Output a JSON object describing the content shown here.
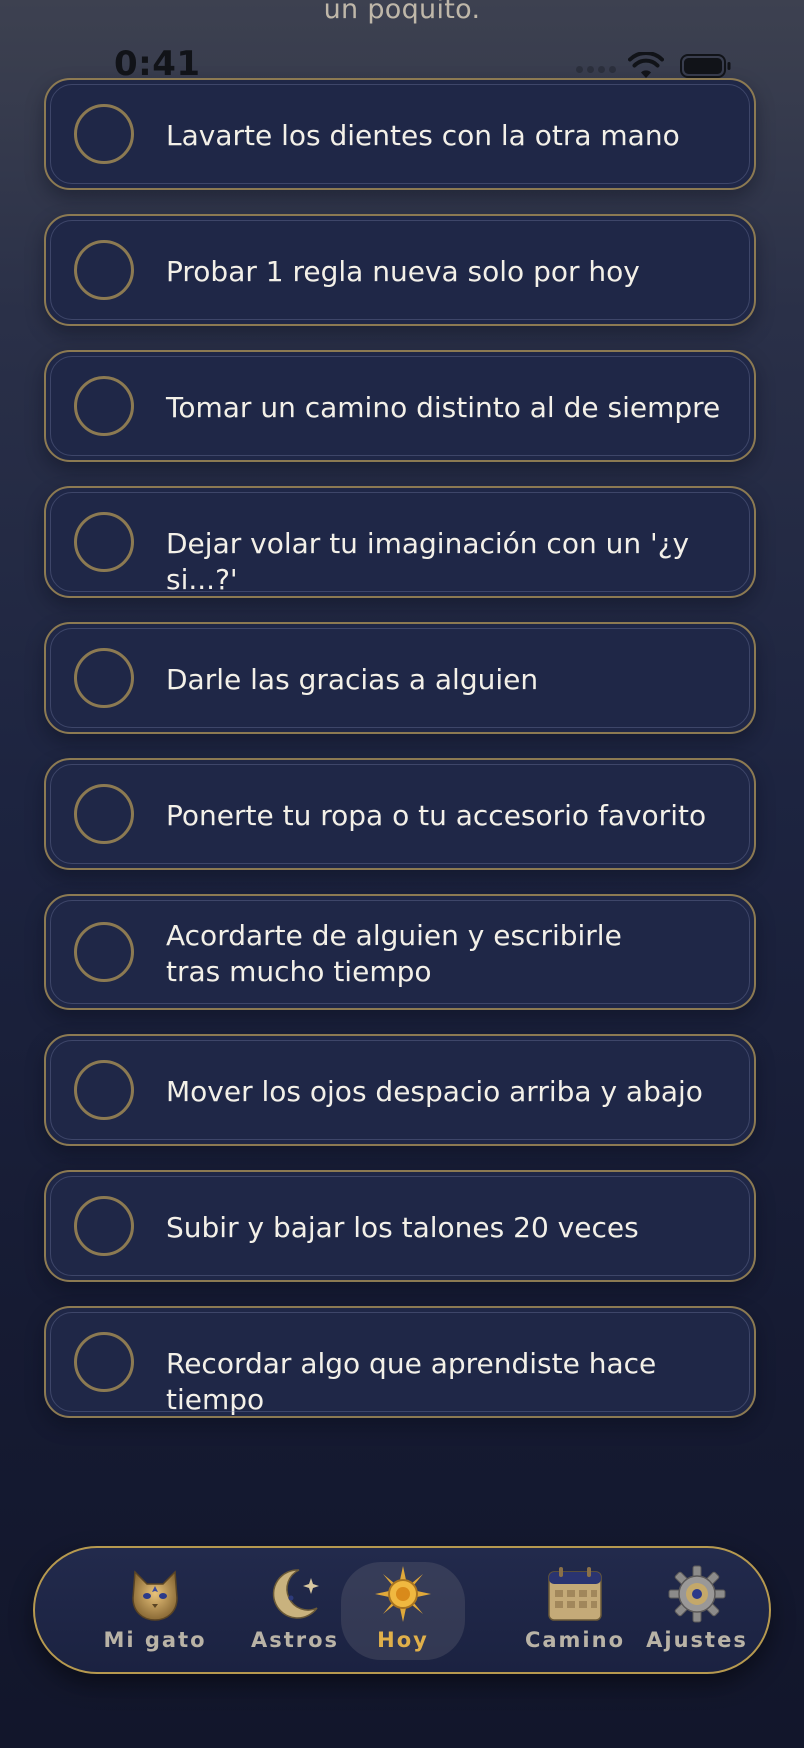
{
  "header": {
    "faded_text": "un poquito."
  },
  "status_bar": {
    "time": "0:41"
  },
  "tasks": [
    {
      "label": "Lavarte los dientes con la otra mano",
      "done": false
    },
    {
      "label": "Probar 1 regla nueva solo por hoy",
      "done": false
    },
    {
      "label": "Tomar un camino distinto al de siempre",
      "done": false
    },
    {
      "label": "Dejar volar tu imaginación con un '¿y si...?'",
      "done": false
    },
    {
      "label": "Darle las gracias a alguien",
      "done": false
    },
    {
      "label": "Ponerte tu ropa o tu accesorio favorito",
      "done": false
    },
    {
      "label": "Acordarte de alguien y escribirle tras mucho tiempo",
      "done": false
    },
    {
      "label": "Mover los ojos despacio arriba y abajo",
      "done": false
    },
    {
      "label": "Subir y bajar los talones 20 veces",
      "done": false
    },
    {
      "label": "Recordar algo que aprendiste hace tiempo",
      "done": false
    }
  ],
  "tabbar": {
    "tabs": [
      {
        "label": "Mi gato",
        "icon": "cat-icon",
        "active": false
      },
      {
        "label": "Astros",
        "icon": "moon-star-icon",
        "active": false
      },
      {
        "label": "Hoy",
        "icon": "sun-icon",
        "active": true
      },
      {
        "label": "Camino",
        "icon": "calendar-icon",
        "active": false
      },
      {
        "label": "Ajustes",
        "icon": "gear-icon",
        "active": false
      }
    ]
  },
  "colors": {
    "gold_border": "#8c7a52",
    "card_bg": "#1f2747",
    "active_tab_text": "#e0b04a"
  }
}
